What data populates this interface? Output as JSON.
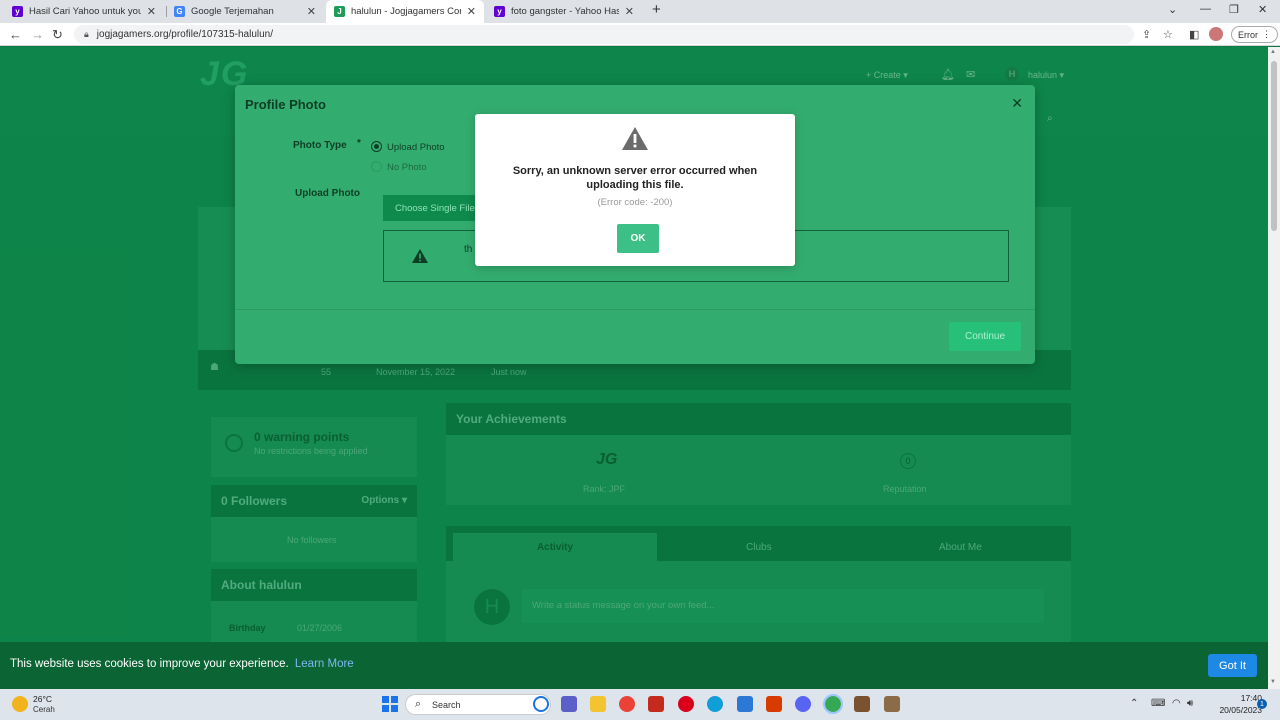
{
  "browser": {
    "tabs": [
      {
        "title": "Hasil Cari Yahoo untuk youtube",
        "favicon": "yahoo-icon"
      },
      {
        "title": "Google Terjemahan",
        "favicon": "google-translate-icon"
      },
      {
        "title": "halulun - Jogjagamers Communi",
        "favicon": "jogjagamers-icon",
        "active": true
      },
      {
        "title": "foto gangster - Yahoo Hasil Imag",
        "favicon": "yahoo-icon"
      }
    ],
    "url": "jogjagamers.org/profile/107315-halulun/",
    "error_pill": "Error"
  },
  "site": {
    "logo": "JG",
    "nav_create": "+ Create ▾",
    "nav_user": "halulun ▾",
    "nav_avatar": "H"
  },
  "profile": {
    "posts": "55",
    "joined": "November 15, 2022",
    "last_visit": "Just now",
    "warning_points": "0 warning points",
    "warning_sub": "No restrictions being applied",
    "followers": "0 Followers",
    "options": "Options ▾",
    "no_followers": "No followers",
    "about_title": "About halulun",
    "birthday_label": "Birthday",
    "birthday_value": "01/27/2006",
    "achievements_title": "Your Achievements",
    "rank_label": "Rank: JPF",
    "rank_icon": "JG",
    "reputation_value": "0",
    "reputation_label": "Reputation",
    "tabs": [
      "Activity",
      "Clubs",
      "About Me"
    ],
    "status_placeholder": "Write a status message on your own feed...",
    "status_avatar": "H"
  },
  "modal": {
    "title": "Profile Photo",
    "photo_type_label": "Photo Type",
    "required_mark": "*",
    "opt_upload": "Upload Photo",
    "opt_none": "No Photo",
    "upload_label": "Upload Photo",
    "choose_btn": "Choose Single File",
    "warning_text": "th",
    "continue_btn": "Continue"
  },
  "error_dialog": {
    "title": "Sorry, an unknown server error occurred when uploading this file.",
    "code": "(Error code: -200)",
    "ok": "OK"
  },
  "cookie": {
    "text": "This website uses cookies to improve your experience.",
    "link": "Learn More",
    "button": "Got It"
  },
  "taskbar": {
    "temp": "26°C",
    "weather": "Cerah",
    "search": "Search",
    "time": "17:40",
    "date": "20/05/2023",
    "notifications": "1"
  },
  "colors": {
    "accent_green": "#13a05a",
    "ok_button": "#3cc087",
    "cookie_bar": "#0b6433",
    "got_it": "#1e88e5"
  }
}
